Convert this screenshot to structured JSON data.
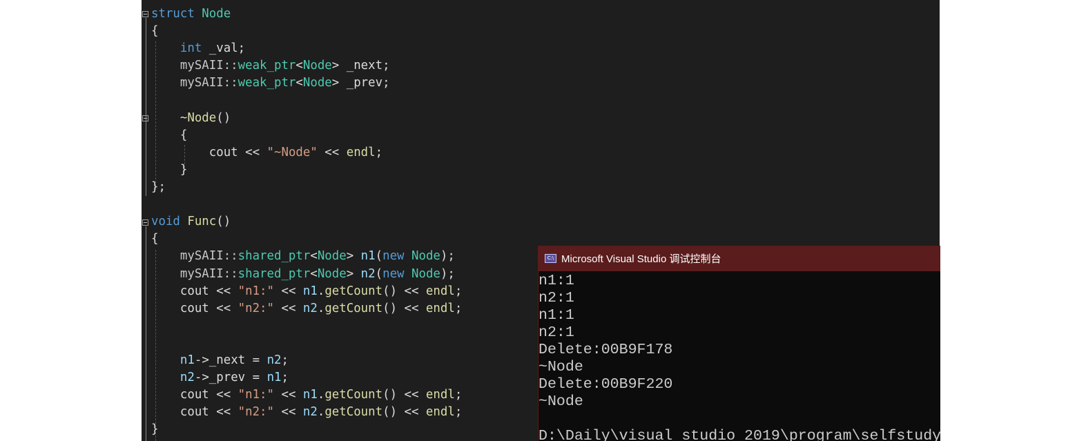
{
  "editor": {
    "lines": [
      [
        {
          "t": "struct ",
          "c": "kw"
        },
        {
          "t": "Node",
          "c": "ty"
        }
      ],
      [
        {
          "t": "{",
          "c": "df"
        }
      ],
      [
        {
          "t": "    ",
          "c": "df"
        },
        {
          "t": "int",
          "c": "kw"
        },
        {
          "t": " _val;",
          "c": "df"
        }
      ],
      [
        {
          "t": "    mySAII::",
          "c": "ns"
        },
        {
          "t": "weak_ptr",
          "c": "ty"
        },
        {
          "t": "<",
          "c": "df"
        },
        {
          "t": "Node",
          "c": "ty"
        },
        {
          "t": "> _next;",
          "c": "df"
        }
      ],
      [
        {
          "t": "    mySAII::",
          "c": "ns"
        },
        {
          "t": "weak_ptr",
          "c": "ty"
        },
        {
          "t": "<",
          "c": "df"
        },
        {
          "t": "Node",
          "c": "ty"
        },
        {
          "t": "> _prev;",
          "c": "df"
        }
      ],
      [],
      [
        {
          "t": "    ~",
          "c": "df"
        },
        {
          "t": "Node",
          "c": "fn"
        },
        {
          "t": "()",
          "c": "df"
        }
      ],
      [
        {
          "t": "    {",
          "c": "df"
        }
      ],
      [
        {
          "t": "        cout << ",
          "c": "df"
        },
        {
          "t": "\"~Node\"",
          "c": "st"
        },
        {
          "t": " << ",
          "c": "df"
        },
        {
          "t": "endl",
          "c": "fn"
        },
        {
          "t": ";",
          "c": "df"
        }
      ],
      [
        {
          "t": "    }",
          "c": "df"
        }
      ],
      [
        {
          "t": "};",
          "c": "df"
        }
      ],
      [],
      [
        {
          "t": "void ",
          "c": "kw"
        },
        {
          "t": "Func",
          "c": "fn"
        },
        {
          "t": "()",
          "c": "df"
        }
      ],
      [
        {
          "t": "{",
          "c": "df"
        }
      ],
      [
        {
          "t": "    mySAII::",
          "c": "ns"
        },
        {
          "t": "shared_ptr",
          "c": "ty"
        },
        {
          "t": "<",
          "c": "df"
        },
        {
          "t": "Node",
          "c": "ty"
        },
        {
          "t": "> ",
          "c": "df"
        },
        {
          "t": "n1",
          "c": "id"
        },
        {
          "t": "(",
          "c": "df"
        },
        {
          "t": "new ",
          "c": "kw"
        },
        {
          "t": "Node",
          "c": "ty"
        },
        {
          "t": ");",
          "c": "df"
        }
      ],
      [
        {
          "t": "    mySAII::",
          "c": "ns"
        },
        {
          "t": "shared_ptr",
          "c": "ty"
        },
        {
          "t": "<",
          "c": "df"
        },
        {
          "t": "Node",
          "c": "ty"
        },
        {
          "t": "> ",
          "c": "df"
        },
        {
          "t": "n2",
          "c": "id"
        },
        {
          "t": "(",
          "c": "df"
        },
        {
          "t": "new ",
          "c": "kw"
        },
        {
          "t": "Node",
          "c": "ty"
        },
        {
          "t": ");",
          "c": "df"
        }
      ],
      [
        {
          "t": "    cout << ",
          "c": "df"
        },
        {
          "t": "\"n1:\"",
          "c": "st"
        },
        {
          "t": " << ",
          "c": "df"
        },
        {
          "t": "n1",
          "c": "id"
        },
        {
          "t": ".",
          "c": "df"
        },
        {
          "t": "getCount",
          "c": "fn"
        },
        {
          "t": "() << ",
          "c": "df"
        },
        {
          "t": "endl",
          "c": "fn"
        },
        {
          "t": ";",
          "c": "df"
        }
      ],
      [
        {
          "t": "    cout << ",
          "c": "df"
        },
        {
          "t": "\"n2:\"",
          "c": "st"
        },
        {
          "t": " << ",
          "c": "df"
        },
        {
          "t": "n2",
          "c": "id"
        },
        {
          "t": ".",
          "c": "df"
        },
        {
          "t": "getCount",
          "c": "fn"
        },
        {
          "t": "() << ",
          "c": "df"
        },
        {
          "t": "endl",
          "c": "fn"
        },
        {
          "t": ";",
          "c": "df"
        }
      ],
      [],
      [],
      [
        {
          "t": "    ",
          "c": "df"
        },
        {
          "t": "n1",
          "c": "id"
        },
        {
          "t": "->",
          "c": "df"
        },
        {
          "t": "_next",
          "c": "df"
        },
        {
          "t": " = ",
          "c": "df"
        },
        {
          "t": "n2",
          "c": "id"
        },
        {
          "t": ";",
          "c": "df"
        }
      ],
      [
        {
          "t": "    ",
          "c": "df"
        },
        {
          "t": "n2",
          "c": "id"
        },
        {
          "t": "->",
          "c": "df"
        },
        {
          "t": "_prev",
          "c": "df"
        },
        {
          "t": " = ",
          "c": "df"
        },
        {
          "t": "n1",
          "c": "id"
        },
        {
          "t": ";",
          "c": "df"
        }
      ],
      [
        {
          "t": "    cout << ",
          "c": "df"
        },
        {
          "t": "\"n1:\"",
          "c": "st"
        },
        {
          "t": " << ",
          "c": "df"
        },
        {
          "t": "n1",
          "c": "id"
        },
        {
          "t": ".",
          "c": "df"
        },
        {
          "t": "getCount",
          "c": "fn"
        },
        {
          "t": "() << ",
          "c": "df"
        },
        {
          "t": "endl",
          "c": "fn"
        },
        {
          "t": ";",
          "c": "df"
        }
      ],
      [
        {
          "t": "    cout << ",
          "c": "df"
        },
        {
          "t": "\"n2:\"",
          "c": "st"
        },
        {
          "t": " << ",
          "c": "df"
        },
        {
          "t": "n2",
          "c": "id"
        },
        {
          "t": ".",
          "c": "df"
        },
        {
          "t": "getCount",
          "c": "fn"
        },
        {
          "t": "() << ",
          "c": "df"
        },
        {
          "t": "endl",
          "c": "fn"
        },
        {
          "t": ";",
          "c": "df"
        }
      ],
      [
        {
          "t": "}",
          "c": "df"
        }
      ]
    ]
  },
  "console": {
    "title": "Microsoft Visual Studio 调试控制台",
    "icon": "console-app-icon",
    "icon_text": "C:\\",
    "output": [
      "n1:1",
      "n2:1",
      "n1:1",
      "n2:1",
      "Delete:00B9F178",
      "~Node",
      "Delete:00B9F220",
      "~Node",
      "",
      "D:\\Daily\\visual studio 2019\\program\\selfstudy"
    ]
  },
  "colors": {
    "editor_bg": "#1e1e1e",
    "keyword": "#569cd6",
    "type": "#4ec9b0",
    "string": "#d69d85",
    "function": "#dcdcaa",
    "identifier": "#9cdcfe",
    "console_title_bg": "#5a1c1c",
    "console_bg": "#0c0c0c"
  }
}
